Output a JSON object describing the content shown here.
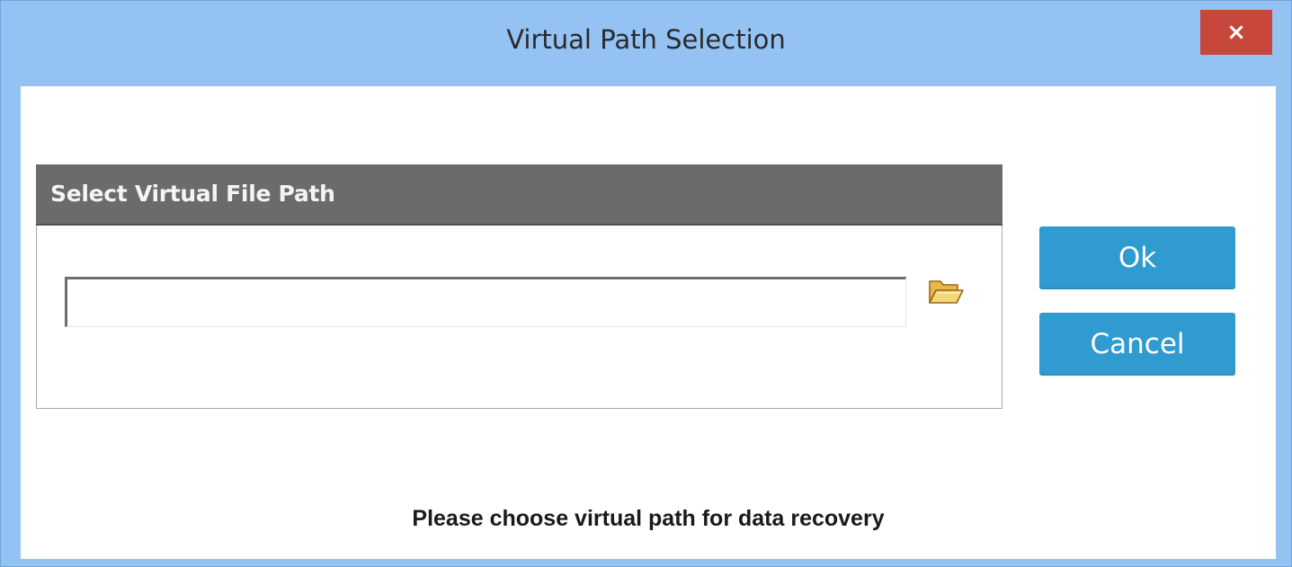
{
  "window": {
    "title": "Virtual Path Selection",
    "close_label": "×",
    "colors": {
      "frame": "#93c2f3",
      "close": "#c7473c",
      "header": "#6b6b6b",
      "button": "#2f9bd0"
    }
  },
  "group": {
    "header": "Select Virtual File Path",
    "path_value": "",
    "path_placeholder": "",
    "browse_icon": "folder-open-icon"
  },
  "buttons": {
    "ok": "Ok",
    "cancel": "Cancel"
  },
  "status": {
    "message": "Please choose virtual path for data recovery"
  }
}
